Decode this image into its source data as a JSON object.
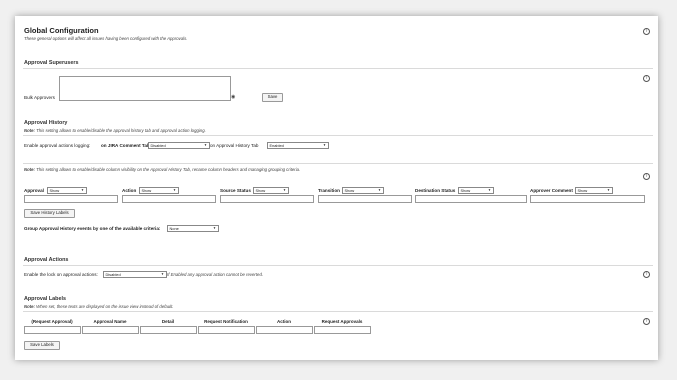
{
  "header": {
    "title": "Global Configuration",
    "subtitle": "These general options will affect all issues having been configured with the Approvals."
  },
  "superusers": {
    "heading": "Approval Superusers",
    "bulk_label": "Bulk Approvers",
    "save_label": "Save"
  },
  "history": {
    "heading": "Approval History",
    "note_prefix": "Note:",
    "note_text": " This setting allows to enable/disable the approval history tab and approval action logging.",
    "logging_label": "Enable approval actions logging:",
    "comment_tab_label": "on JIRA Comment Tab",
    "comment_tab_value": "Disabled",
    "history_tab_label": "on Approval History Tab",
    "history_tab_value": "Enabled",
    "note2_text": " This setting allows to enable/disable column visibility on the Approval History Tab, rename column headers and managing grouping criteria.",
    "columns": [
      {
        "label": "Approval",
        "value": "Show"
      },
      {
        "label": "Action",
        "value": "Show"
      },
      {
        "label": "Source Status",
        "value": "Show"
      },
      {
        "label": "Transition",
        "value": "Show"
      },
      {
        "label": "Destination Status",
        "value": "Show"
      },
      {
        "label": "Approver Comment",
        "value": "Show"
      }
    ],
    "save_labels": "Save History Labels",
    "group_label": "Group Approval History events by one of the available criteria:",
    "group_value": "None"
  },
  "actions": {
    "heading": "Approval Actions",
    "lock_label": "Enable the lock on approval actions:",
    "lock_value": "Disabled",
    "lock_note": "If Enabled any approval action cannot be reverted."
  },
  "labels": {
    "heading": "Approval Labels",
    "note_prefix": "Note:",
    "note_text": " When set, these texts are displayed on the issue view instead of default.",
    "columns": [
      "(Request Approval)",
      "Approval Name",
      "Detail",
      "Request Notification",
      "Action",
      "Request Approvals"
    ],
    "save_label": "Save Labels"
  },
  "icons": {
    "help": "?",
    "eye": "◉",
    "caret": "▼"
  }
}
